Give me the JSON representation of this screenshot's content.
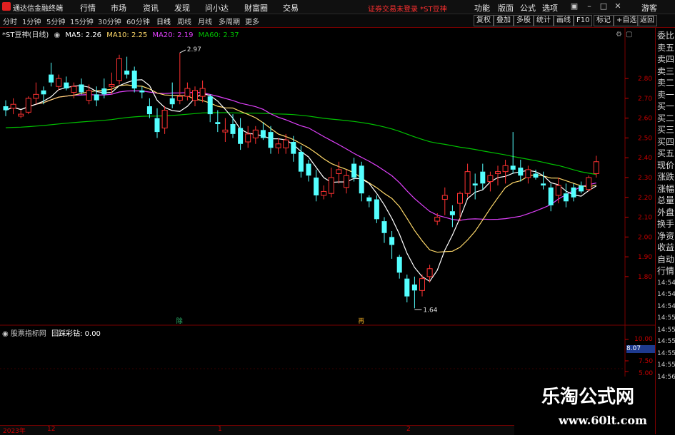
{
  "app": {
    "name": "通达信金融终端"
  },
  "menu": [
    "行情",
    "市场",
    "资讯",
    "发现",
    "问小达",
    "财富圈",
    "交易"
  ],
  "notice": "证券交易未登录 *ST豆神",
  "menu_right": [
    "功能",
    "版面",
    "公式",
    "选项"
  ],
  "guest": "游客",
  "periods": [
    "分时",
    "1分钟",
    "5分钟",
    "15分钟",
    "30分钟",
    "60分钟",
    "日线",
    "周线",
    "月线",
    "多周期",
    "更多"
  ],
  "tool_buttons": [
    "复权",
    "叠加",
    "多股",
    "统计",
    "画线",
    "F10",
    "标记",
    "+自选",
    "返回"
  ],
  "chart_legend": {
    "title": "*ST豆神(日线)",
    "ma5": "MA5: 2.26",
    "ma10": "MA10: 2.25",
    "ma20": "MA20: 2.19",
    "ma60": "MA60: 2.37"
  },
  "colors": {
    "up": "#ff3232",
    "down": "#54ffff",
    "ma5": "#ffffff",
    "ma10": "#ffd96a",
    "ma20": "#e040fb",
    "ma60": "#00c000"
  },
  "annotations": {
    "high": "2.97",
    "low": "1.64",
    "marker1": "除",
    "marker2": "再"
  },
  "right_panel": [
    "委比",
    "卖五",
    "卖四",
    "卖三",
    "卖二",
    "卖一",
    "买一",
    "买二",
    "买三",
    "买四",
    "买五",
    "现价",
    "涨跌",
    "涨幅",
    "总量",
    "外盘",
    "换手",
    "净资",
    "收益",
    "自动",
    "行情",
    "14:54",
    "14:54",
    "14:54",
    "14:55",
    "14:55",
    "14:55",
    "14:55",
    "14:55",
    "14:56"
  ],
  "indicator": {
    "name": "股票指标网",
    "label": "回踩彩钻: 0.00",
    "value": "8.07",
    "ticks": [
      "10.00",
      "7.50",
      "5.00"
    ]
  },
  "bottom_bar": [
    "2023年",
    "12",
    "1",
    "2"
  ],
  "watermark": {
    "line1": "乐淘公式网",
    "line2": "www.60lt.com"
  },
  "chart_data": {
    "type": "candlestick",
    "y_ticks": [
      2.8,
      2.7,
      2.6,
      2.5,
      2.4,
      2.3,
      2.2,
      2.1,
      2.0,
      1.9,
      1.8
    ],
    "ylim": [
      1.58,
      3.02
    ],
    "candles": [
      [
        2.66,
        2.69,
        2.61,
        2.64
      ],
      [
        2.65,
        2.7,
        2.62,
        2.67
      ],
      [
        2.61,
        2.64,
        2.6,
        2.62
      ],
      [
        2.63,
        2.71,
        2.62,
        2.7
      ],
      [
        2.7,
        2.78,
        2.67,
        2.72
      ],
      [
        2.74,
        2.76,
        2.67,
        2.72
      ],
      [
        2.82,
        2.88,
        2.76,
        2.78
      ],
      [
        2.76,
        2.82,
        2.74,
        2.8
      ],
      [
        2.78,
        2.81,
        2.74,
        2.75
      ],
      [
        2.73,
        2.78,
        2.7,
        2.76
      ],
      [
        2.77,
        2.8,
        2.72,
        2.73
      ],
      [
        2.69,
        2.77,
        2.67,
        2.74
      ],
      [
        2.72,
        2.76,
        2.66,
        2.69
      ],
      [
        2.75,
        2.8,
        2.7,
        2.72
      ],
      [
        2.76,
        2.83,
        2.72,
        2.77
      ],
      [
        2.79,
        2.92,
        2.77,
        2.9
      ],
      [
        2.84,
        2.91,
        2.8,
        2.82
      ],
      [
        2.84,
        2.86,
        2.73,
        2.75
      ],
      [
        2.74,
        2.76,
        2.7,
        2.73
      ],
      [
        2.66,
        2.7,
        2.6,
        2.62
      ],
      [
        2.6,
        2.65,
        2.5,
        2.53
      ],
      [
        2.55,
        2.66,
        2.52,
        2.64
      ],
      [
        2.7,
        2.78,
        2.65,
        2.67
      ],
      [
        2.69,
        2.93,
        2.67,
        2.71
      ],
      [
        2.71,
        2.78,
        2.69,
        2.75
      ],
      [
        2.69,
        2.76,
        2.66,
        2.74
      ],
      [
        2.71,
        2.79,
        2.68,
        2.75
      ],
      [
        2.71,
        2.72,
        2.58,
        2.62
      ],
      [
        2.58,
        2.64,
        2.53,
        2.57
      ],
      [
        2.53,
        2.6,
        2.48,
        2.54
      ],
      [
        2.57,
        2.62,
        2.5,
        2.52
      ],
      [
        2.55,
        2.6,
        2.44,
        2.47
      ],
      [
        2.48,
        2.56,
        2.45,
        2.52
      ],
      [
        2.5,
        2.56,
        2.47,
        2.54
      ],
      [
        2.54,
        2.58,
        2.49,
        2.5
      ],
      [
        2.53,
        2.56,
        2.42,
        2.45
      ],
      [
        2.45,
        2.5,
        2.42,
        2.47
      ],
      [
        2.45,
        2.52,
        2.42,
        2.49
      ],
      [
        2.48,
        2.51,
        2.38,
        2.42
      ],
      [
        2.43,
        2.46,
        2.3,
        2.33
      ],
      [
        2.37,
        2.39,
        2.28,
        2.31
      ],
      [
        2.3,
        2.34,
        2.18,
        2.21
      ],
      [
        2.21,
        2.26,
        2.19,
        2.23
      ],
      [
        2.22,
        2.35,
        2.2,
        2.3
      ],
      [
        2.32,
        2.38,
        2.27,
        2.34
      ],
      [
        2.25,
        2.34,
        2.22,
        2.31
      ],
      [
        2.37,
        2.4,
        2.28,
        2.3
      ],
      [
        2.36,
        2.38,
        2.18,
        2.22
      ],
      [
        2.2,
        2.21,
        2.15,
        2.18
      ],
      [
        2.19,
        2.21,
        2.07,
        2.09
      ],
      [
        2.08,
        2.1,
        1.97,
        2.02
      ],
      [
        2.0,
        2.03,
        1.89,
        1.96
      ],
      [
        1.9,
        1.91,
        1.79,
        1.82
      ],
      [
        1.79,
        1.81,
        1.67,
        1.7
      ],
      [
        1.76,
        1.8,
        1.64,
        1.73
      ],
      [
        1.73,
        1.81,
        1.7,
        1.79
      ],
      [
        1.8,
        1.86,
        1.77,
        1.84
      ],
      [
        2.08,
        2.12,
        2.06,
        2.1
      ],
      [
        2.19,
        2.25,
        2.11,
        2.21
      ],
      [
        2.13,
        2.16,
        2.05,
        2.11
      ],
      [
        2.17,
        2.23,
        2.08,
        2.22
      ],
      [
        2.22,
        2.37,
        2.2,
        2.33
      ],
      [
        2.27,
        2.32,
        2.19,
        2.26
      ],
      [
        2.33,
        2.37,
        2.24,
        2.27
      ],
      [
        2.28,
        2.33,
        2.23,
        2.31
      ],
      [
        2.32,
        2.36,
        2.26,
        2.33
      ],
      [
        2.33,
        2.39,
        2.27,
        2.36
      ],
      [
        2.36,
        2.53,
        2.32,
        2.34
      ],
      [
        2.35,
        2.39,
        2.28,
        2.31
      ],
      [
        2.3,
        2.36,
        2.27,
        2.34
      ],
      [
        2.32,
        2.34,
        2.29,
        2.3
      ],
      [
        2.27,
        2.33,
        2.24,
        2.26
      ],
      [
        2.25,
        2.27,
        2.13,
        2.16
      ],
      [
        2.21,
        2.3,
        2.17,
        2.26
      ],
      [
        2.22,
        2.27,
        2.15,
        2.18
      ],
      [
        2.25,
        2.27,
        2.18,
        2.2
      ],
      [
        2.26,
        2.28,
        2.22,
        2.23
      ],
      [
        2.24,
        2.31,
        2.23,
        2.3
      ],
      [
        2.32,
        2.41,
        2.3,
        2.38
      ]
    ]
  }
}
